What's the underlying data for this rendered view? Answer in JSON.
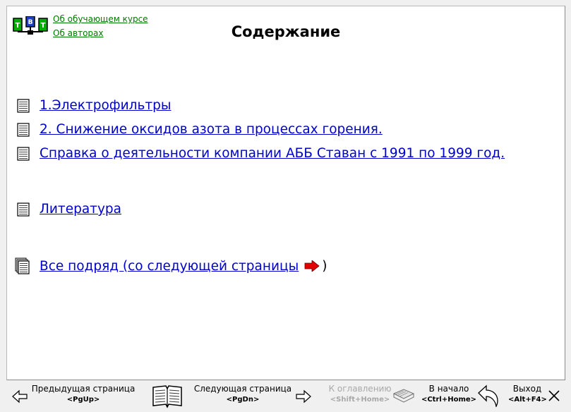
{
  "header": {
    "title": "Содержание",
    "links": [
      "Об обучающем курсе",
      "Об авторах"
    ]
  },
  "toc": {
    "items": [
      {
        "label": "1.Электрофильтры"
      },
      {
        "label": "2. Снижение оксидов азота в процессах горения."
      },
      {
        "label": "Справка о деятельности компании АББ Ставан с 1991 по 1999 год."
      },
      {
        "label": "Литература"
      }
    ],
    "all_label": "Все подряд (со следующей страницы",
    "all_suffix": ")"
  },
  "toolbar": {
    "prev": {
      "label": "Предыдущая страница",
      "key": "<PgUp>"
    },
    "next": {
      "label": "Следующая страница",
      "key": "<PgDn>"
    },
    "toc": {
      "label": "К оглавлению",
      "key": "<Shift+Home>",
      "enabled": false
    },
    "home": {
      "label": "В начало",
      "key": "<Ctrl+Home>"
    },
    "exit": {
      "label": "Выход",
      "key": "<Alt+F4>"
    }
  },
  "colors": {
    "link": "#0000cc",
    "top_link": "#007800",
    "arrow": "#e00000"
  },
  "icons": [
    "logo-icon",
    "document-icon",
    "documents-stack-icon",
    "red-arrow-right-icon",
    "arrow-left-icon",
    "open-book-icon",
    "arrow-right-icon",
    "book-icon",
    "return-arrow-icon",
    "close-x-icon"
  ]
}
